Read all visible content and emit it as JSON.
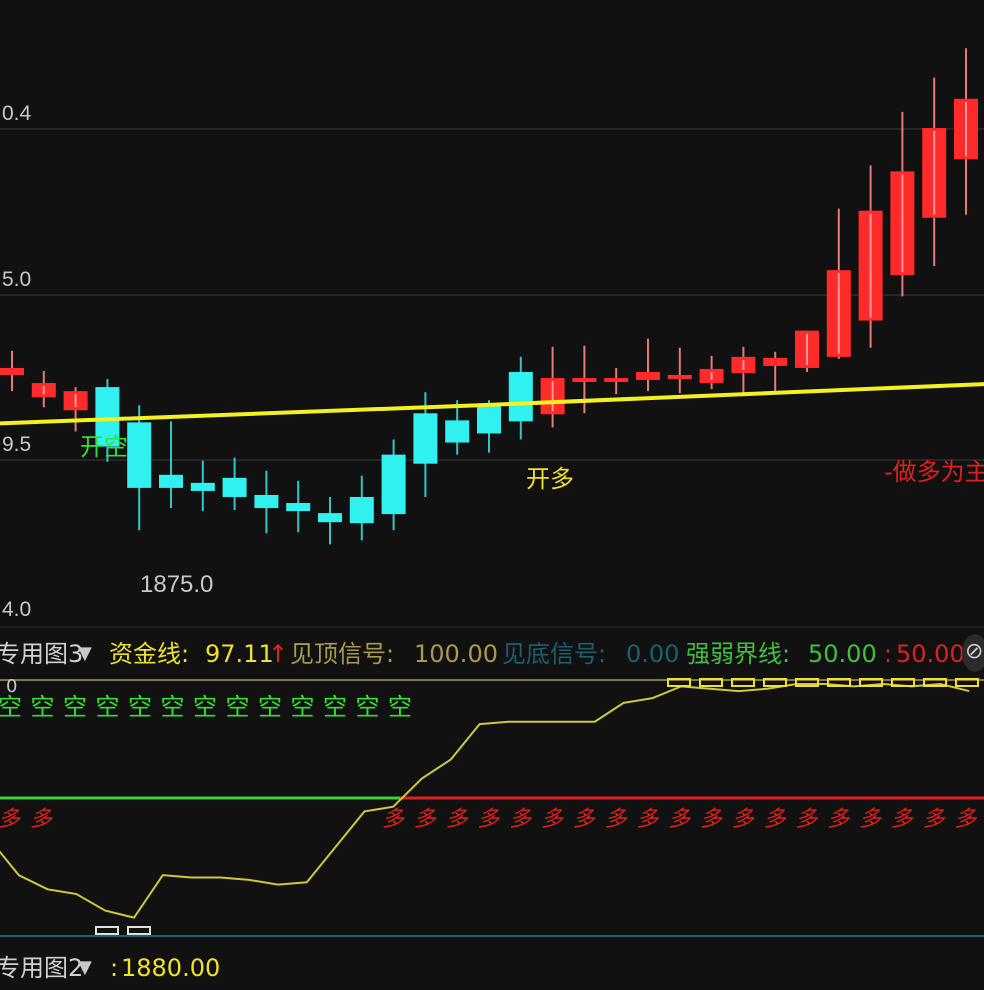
{
  "chart_data": {
    "type": "candlestick",
    "main_panel": {
      "y_ticks": [
        "0.4",
        "5.0",
        "9.5",
        "4.0"
      ],
      "low_marker_label": "1875.0",
      "signals": [
        {
          "label": "开空",
          "color": "#33e033"
        },
        {
          "label": "开多",
          "color": "#f0e030"
        },
        {
          "label": "-做多为主",
          "color": "#e02020"
        }
      ],
      "candles": [
        {
          "o": 1899.5,
          "h": 1901.2,
          "l": 1897.2,
          "c": 1898.8,
          "color": "red"
        },
        {
          "o": 1898.0,
          "h": 1899.2,
          "l": 1895.6,
          "c": 1896.6,
          "color": "red"
        },
        {
          "o": 1897.2,
          "h": 1897.6,
          "l": 1893.2,
          "c": 1895.3,
          "color": "red"
        },
        {
          "o": 1897.6,
          "h": 1898.4,
          "l": 1890.2,
          "c": 1891.7,
          "color": "cyan"
        },
        {
          "o": 1894.1,
          "h": 1895.8,
          "l": 1883.4,
          "c": 1887.6,
          "color": "cyan"
        },
        {
          "o": 1888.9,
          "h": 1894.2,
          "l": 1885.6,
          "c": 1887.6,
          "color": "cyan"
        },
        {
          "o": 1888.1,
          "h": 1890.3,
          "l": 1885.3,
          "c": 1887.3,
          "color": "cyan"
        },
        {
          "o": 1888.6,
          "h": 1890.6,
          "l": 1885.4,
          "c": 1886.7,
          "color": "cyan"
        },
        {
          "o": 1886.9,
          "h": 1889.3,
          "l": 1883.1,
          "c": 1885.6,
          "color": "cyan"
        },
        {
          "o": 1886.1,
          "h": 1888.3,
          "l": 1883.2,
          "c": 1885.3,
          "color": "cyan"
        },
        {
          "o": 1885.1,
          "h": 1886.7,
          "l": 1882.0,
          "c": 1884.2,
          "color": "cyan"
        },
        {
          "o": 1886.7,
          "h": 1888.8,
          "l": 1882.4,
          "c": 1884.1,
          "color": "cyan"
        },
        {
          "o": 1885.0,
          "h": 1892.4,
          "l": 1883.4,
          "c": 1890.9,
          "color": "cyan"
        },
        {
          "o": 1890.0,
          "h": 1897.1,
          "l": 1886.7,
          "c": 1895.0,
          "color": "cyan"
        },
        {
          "o": 1892.1,
          "h": 1896.3,
          "l": 1890.9,
          "c": 1894.3,
          "color": "cyan"
        },
        {
          "o": 1893.0,
          "h": 1896.3,
          "l": 1891.1,
          "c": 1895.8,
          "color": "cyan"
        },
        {
          "o": 1894.2,
          "h": 1900.6,
          "l": 1892.4,
          "c": 1899.1,
          "color": "cyan"
        },
        {
          "o": 1894.9,
          "h": 1901.6,
          "l": 1893.6,
          "c": 1898.5,
          "color": "red"
        },
        {
          "o": 1898.2,
          "h": 1901.7,
          "l": 1895.0,
          "c": 1898.5,
          "color": "red"
        },
        {
          "o": 1898.5,
          "h": 1899.5,
          "l": 1896.9,
          "c": 1898.2,
          "color": "red"
        },
        {
          "o": 1898.3,
          "h": 1902.4,
          "l": 1897.2,
          "c": 1899.1,
          "color": "red"
        },
        {
          "o": 1898.6,
          "h": 1901.5,
          "l": 1897.0,
          "c": 1898.8,
          "color": "red"
        },
        {
          "o": 1898.0,
          "h": 1900.7,
          "l": 1897.4,
          "c": 1899.4,
          "color": "red"
        },
        {
          "o": 1899.0,
          "h": 1901.6,
          "l": 1896.7,
          "c": 1900.6,
          "color": "red"
        },
        {
          "o": 1899.7,
          "h": 1901.1,
          "l": 1897.1,
          "c": 1900.5,
          "color": "red"
        },
        {
          "o": 1899.5,
          "h": 1902.2,
          "l": 1899.1,
          "c": 1903.2,
          "color": "red"
        },
        {
          "o": 1900.6,
          "h": 1915.3,
          "l": 1900.4,
          "c": 1909.2,
          "color": "red"
        },
        {
          "o": 1904.2,
          "h": 1919.6,
          "l": 1901.5,
          "c": 1915.1,
          "color": "red"
        },
        {
          "o": 1908.7,
          "h": 1924.9,
          "l": 1906.6,
          "c": 1919.0,
          "color": "red"
        },
        {
          "o": 1914.4,
          "h": 1928.3,
          "l": 1909.6,
          "c": 1923.3,
          "color": "red"
        },
        {
          "o": 1920.2,
          "h": 1931.2,
          "l": 1914.7,
          "c": 1926.2,
          "color": "red"
        },
        {
          "o": 1925.1,
          "h": 1934.4,
          "l": 1918.9,
          "c": 1930.2,
          "color": "red"
        }
      ],
      "ma_line_values": [
        1894.0,
        1895.9,
        1897.9
      ],
      "ma_color": "#f5f020"
    },
    "indicator_panel": {
      "name": "专用图3",
      "fields": [
        {
          "label": "资金线:",
          "value": "97.11",
          "arrow": "↑",
          "label_color": "#f0e030",
          "value_color": "#f0e030"
        },
        {
          "label": "见顶信号:",
          "value": "100.00",
          "label_color": "#a89a50",
          "value_color": "#a89a50"
        },
        {
          "label": "见底信号:",
          "value": "0.00",
          "label_color": "#1e5e6e",
          "value_color": "#1e5e6e"
        },
        {
          "label": "强弱界线:",
          "value": "50.00",
          "label_color": "#40c040",
          "value_color": "#40c040"
        },
        {
          "label": ":",
          "value": "50.00",
          "label_color": "#e02020",
          "value_color": "#e02020"
        }
      ],
      "top_tick": "0",
      "short_marker": "空",
      "long_marker": "多",
      "fund_line": [
        34,
        19,
        13,
        11,
        4,
        1,
        19,
        18,
        18,
        17,
        15,
        16,
        31,
        46,
        48,
        60,
        68,
        83,
        84,
        84,
        84,
        84,
        92,
        94,
        99,
        98,
        97,
        98,
        100,
        100,
        99,
        100,
        99,
        100,
        97
      ],
      "fund_color": "#d0c840",
      "strength_line_value": 50
    },
    "bottom_panel": {
      "name": "专用图2",
      "value": "1880.00",
      "value_color": "#f0e030"
    }
  }
}
